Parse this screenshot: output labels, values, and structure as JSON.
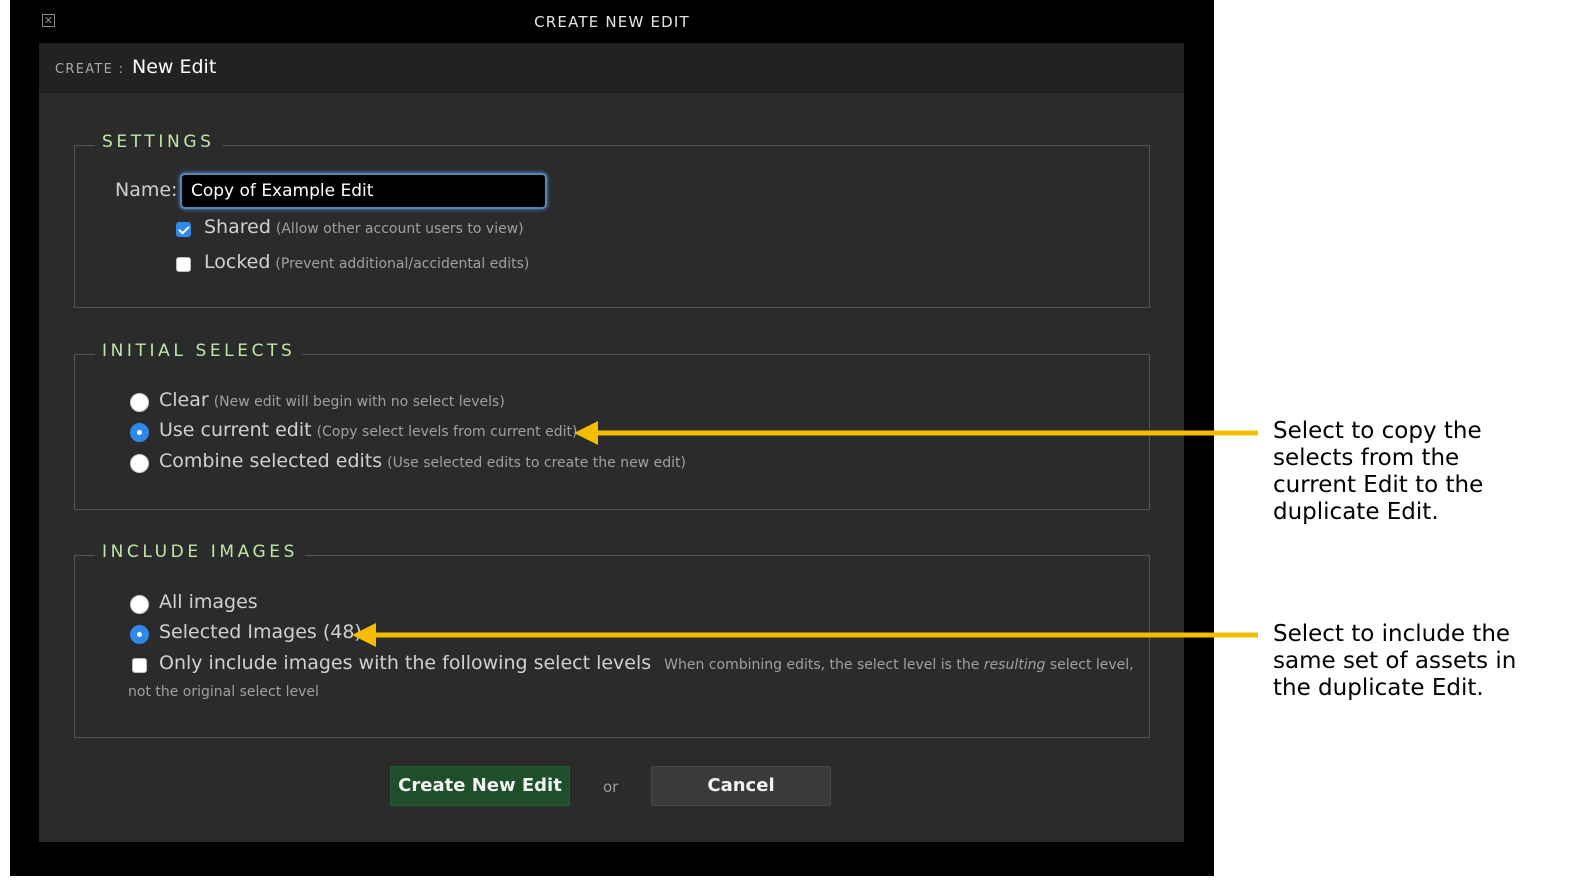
{
  "window": {
    "title": "CREATE NEW EDIT",
    "close_icon": "close-box-icon"
  },
  "header": {
    "create_label": "CREATE :",
    "edit_name": "New Edit"
  },
  "settings": {
    "legend": "SETTINGS",
    "name_label": "Name:",
    "name_value": "Copy of Example Edit",
    "shared": {
      "label": "Shared",
      "hint": "(Allow other account users to view)",
      "checked": true
    },
    "locked": {
      "label": "Locked",
      "hint": "(Prevent additional/accidental edits)",
      "checked": false
    }
  },
  "initial_selects": {
    "legend": "INITIAL SELECTS",
    "options": [
      {
        "label": "Clear",
        "hint": "(New edit will begin with no select levels)",
        "selected": false
      },
      {
        "label": "Use current edit",
        "hint": "(Copy select levels from current edit)",
        "selected": true
      },
      {
        "label": "Combine selected edits",
        "hint": "(Use selected edits to create the new edit)",
        "selected": false
      }
    ]
  },
  "include_images": {
    "legend": "INCLUDE IMAGES",
    "options": [
      {
        "label": "All images",
        "selected": false
      },
      {
        "label": "Selected Images (48)",
        "selected": true
      }
    ],
    "only_include": {
      "label": "Only include images with the following select levels",
      "hint_before": "When combining edits, the select level is the",
      "hint_emphasis": "resulting",
      "hint_after": "select level,",
      "hint_line2": "not the original select level",
      "checked": false
    }
  },
  "actions": {
    "create_label": "Create New Edit",
    "or_label": "or",
    "cancel_label": "Cancel"
  },
  "annotations": {
    "callout_1": [
      "Select to copy the",
      "selects from the",
      "current Edit to the",
      "duplicate Edit."
    ],
    "callout_2": [
      "Select to include the",
      "same set of assets in",
      "the duplicate Edit."
    ],
    "arrow_color": "#f5bd00"
  },
  "colors": {
    "legend_green": "#bfe7a5",
    "accent_blue": "#2f88ea",
    "primary_button": "#1e4f2b"
  }
}
